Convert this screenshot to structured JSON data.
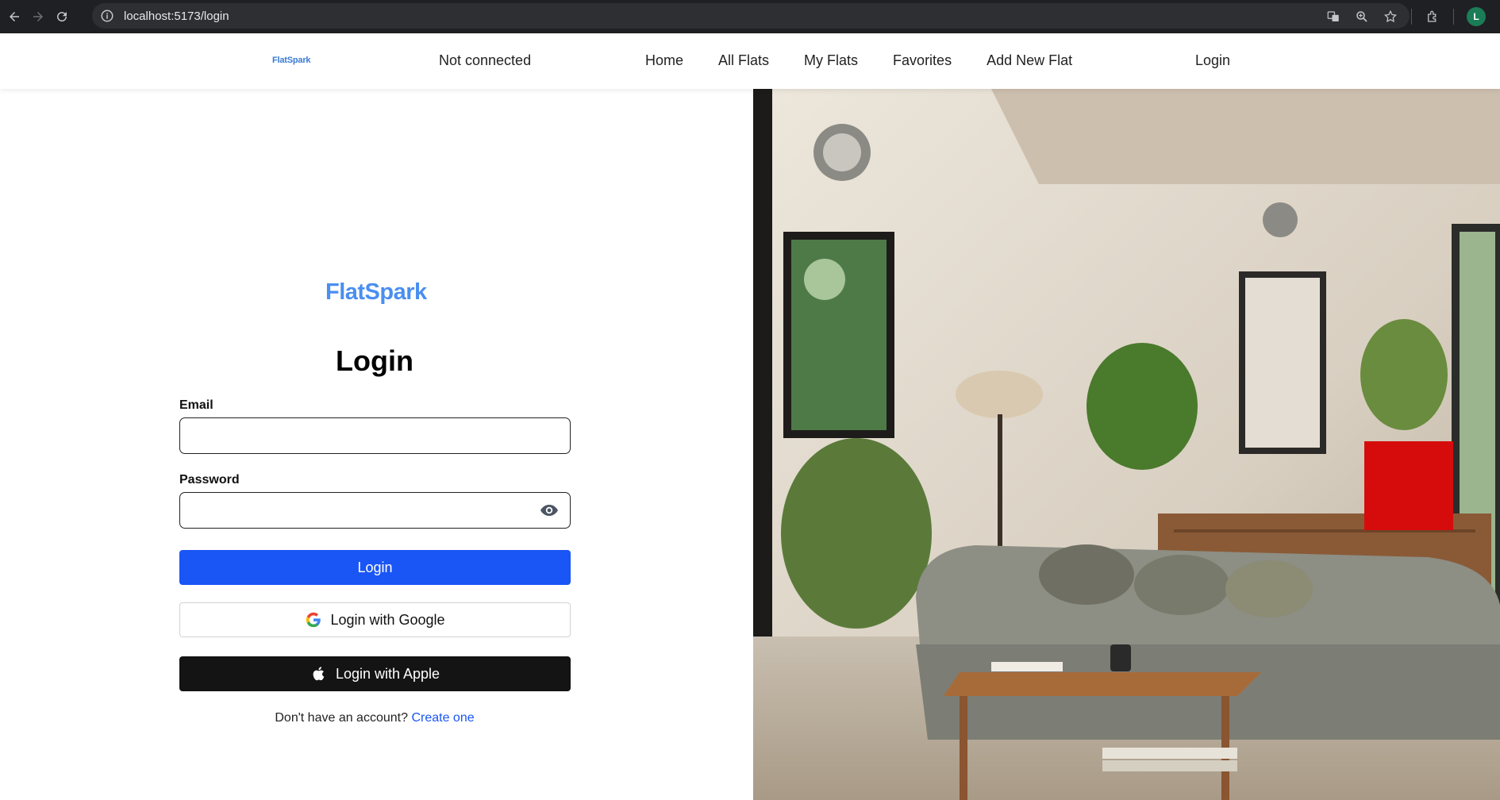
{
  "browser": {
    "url": "localhost:5173/login",
    "profile_initial": "L",
    "icons": [
      "back-icon",
      "forward-icon",
      "reload-icon",
      "site-info-icon",
      "translate-icon",
      "zoom-icon",
      "bookmark-star-icon",
      "extensions-icon"
    ]
  },
  "header": {
    "logo": "FlatSpark",
    "status": "Not connected",
    "nav": [
      "Home",
      "All Flats",
      "My Flats",
      "Favorites",
      "Add New Flat"
    ],
    "login": "Login"
  },
  "form": {
    "brand": "FlatSpark",
    "title": "Login",
    "email_label": "Email",
    "email_value": "",
    "password_label": "Password",
    "password_value": "",
    "submit": "Login",
    "google": "Login with Google",
    "apple": "Login with Apple",
    "signup_prompt": "Don't have an account?",
    "signup_link": "Create one"
  },
  "colors": {
    "primary": "#1a55f5",
    "brand": "#4a8ef0",
    "apple_button": "#141414"
  }
}
